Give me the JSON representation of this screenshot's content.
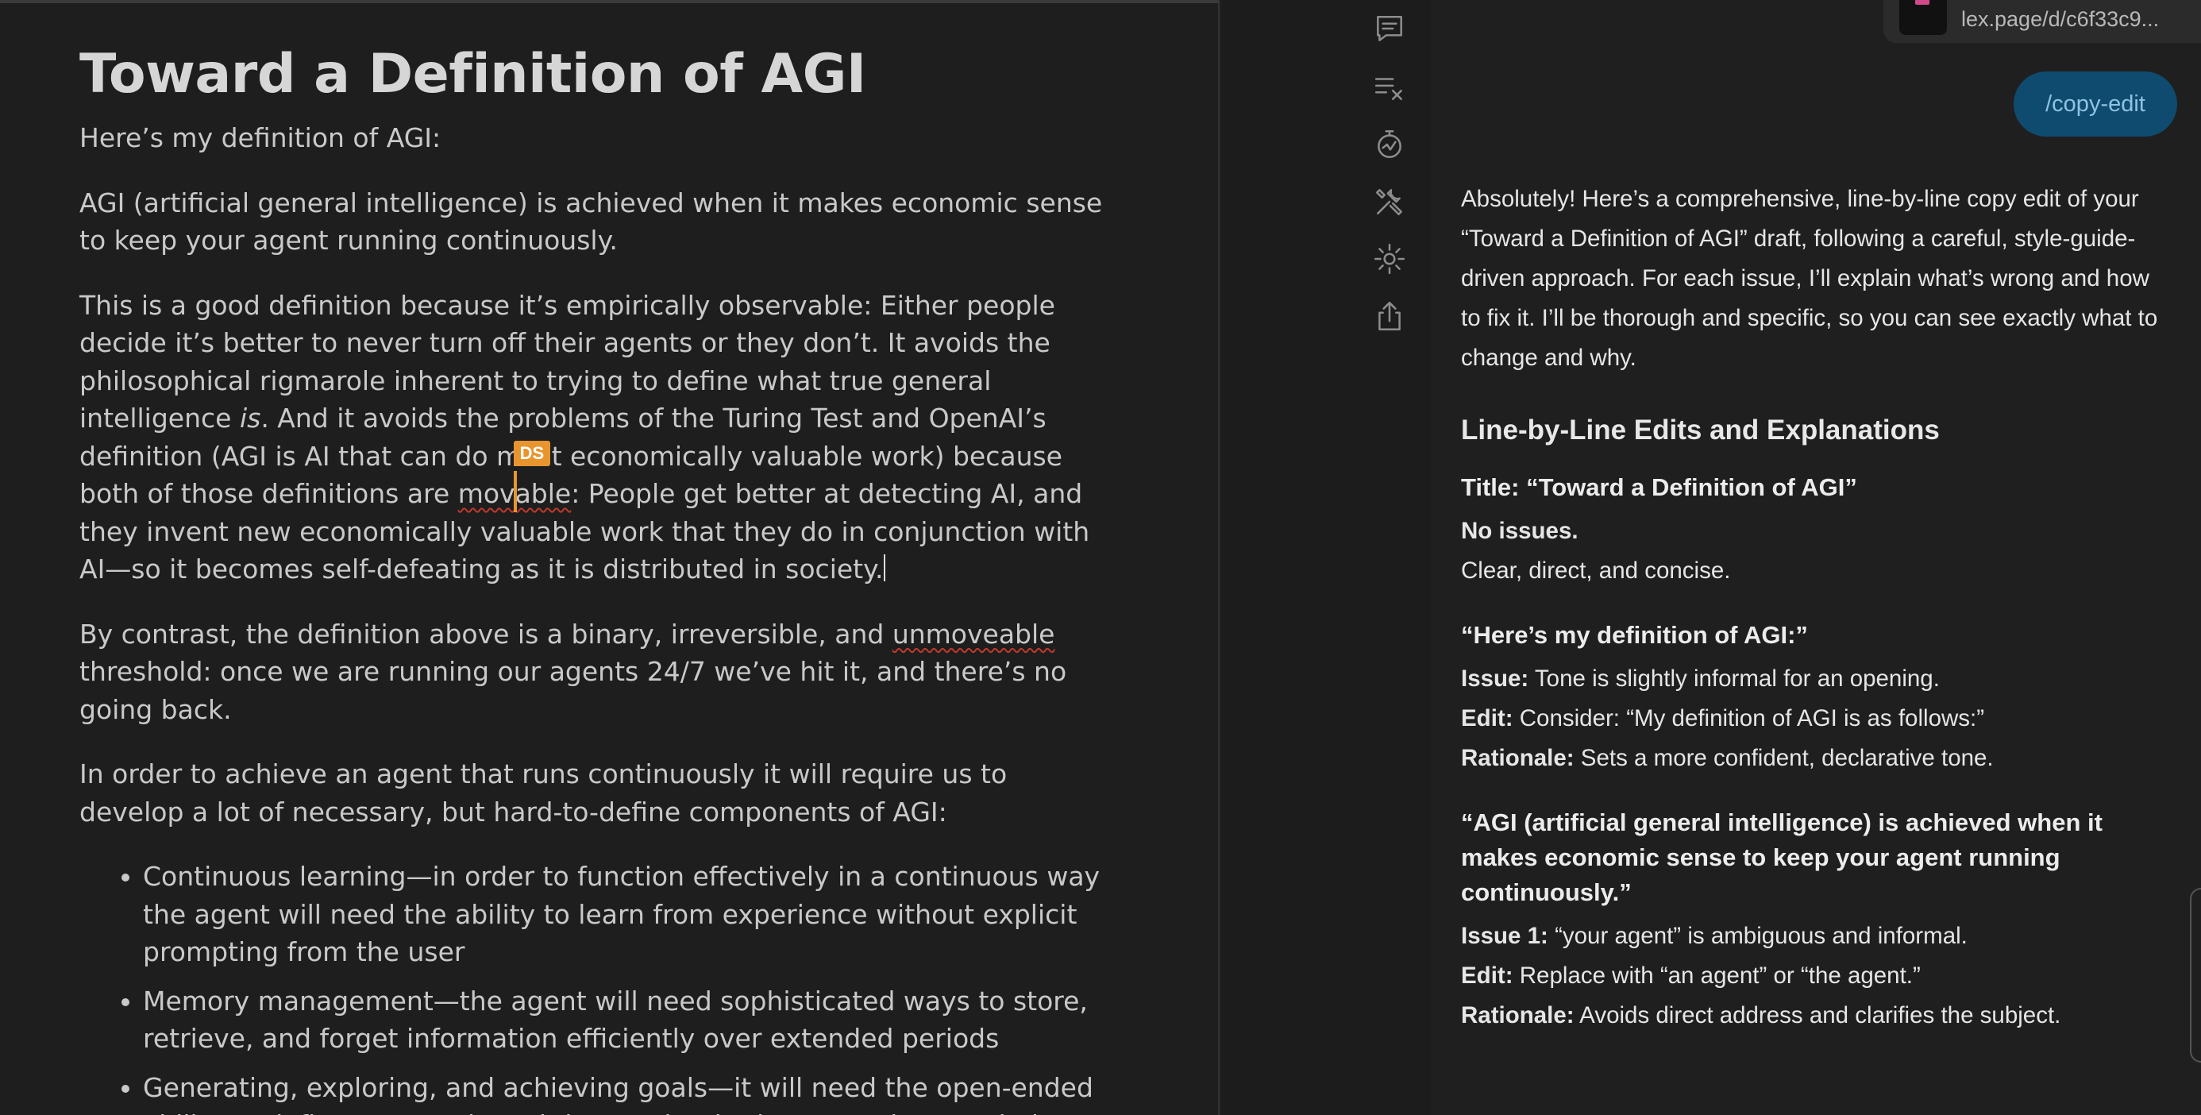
{
  "editor": {
    "title": "Toward a Definition of AGI",
    "intro": "Here’s my definition of AGI:",
    "p1": "AGI (artificial general intelligence) is achieved when it makes economic sense to keep your agent running continuously.",
    "p2a": "This is a good definition because it’s empirically observable: Either people decide it’s better to never turn off their agents or they don’t. It avoids the philosophical rigmarole inherent to trying to define what true general intelligence ",
    "p2_em": "is",
    "p2b": ". And it avoids the problems of the Turing Test and OpenAI’s definition (AGI is AI that can do most economically valuable work) because both of those definitions are ",
    "p2_spell1": "mov",
    "p2_spell2": "able",
    "p2c": ": People get better at detecting AI, and they invent new economically valuable work that they do in conjunction with AI—so it becomes self-defeating as it is distributed in society.",
    "collab_initials": "DS",
    "p3a": "By contrast, the definition above is a binary, irreversible, and ",
    "p3_spell": "unmoveable",
    "p3b": " threshold: once we are running our agents 24/7 we’ve hit it, and there’s no going back.",
    "p4": "In order to achieve an agent that runs continuously it will require us to develop a lot of necessary, but hard-to-define components of AGI:",
    "bullets": [
      "Continuous learning—in order to function effectively in a continuous way the agent will need the ability to learn from experience without explicit prompting from the user",
      "Memory management—the agent will need sophisticated ways to store, retrieve, and forget information efficiently over extended periods",
      "Generating, exploring, and achieving goals—it will need the open-ended ability to define new goals and then maintain them over long periods"
    ]
  },
  "rail": {
    "icons": [
      "comment-icon",
      "checklist-clear-icon",
      "timer-icon",
      "tools-icon",
      "settings-icon",
      "share-icon"
    ]
  },
  "chat": {
    "link_url": "lex.page/d/c6f33c9...",
    "command": "/copy-edit",
    "intro": "Absolutely! Here’s a comprehensive, line-by-line copy edit of your “Toward a Definition of AGI” draft, following a careful, style-guide-driven approach. For each issue, I’ll explain what’s wrong and how to fix it. I’ll be thorough and specific, so you can see exactly what to change and why.",
    "section_heading": "Line-by-Line Edits and Explanations",
    "items": [
      {
        "heading": "Title: “Toward a Definition of AGI”",
        "l1_label": "No issues.",
        "l2_text": "Clear, direct, and concise."
      },
      {
        "heading": "“Here’s my definition of AGI:”",
        "issue_label": "Issue:",
        "issue_text": " Tone is slightly informal for an opening.",
        "edit_label": "Edit:",
        "edit_text": " Consider: “My definition of AGI is as follows:”",
        "rat_label": "Rationale:",
        "rat_text": " Sets a more confident, declarative tone."
      },
      {
        "heading": "“AGI (artificial general intelligence) is achieved when it makes economic sense to keep your agent running continuously.”",
        "issue_label": "Issue 1:",
        "issue_text": " “your agent” is ambiguous and informal.",
        "edit_label": "Edit:",
        "edit_text": " Replace with “an agent” or “the agent.”",
        "rat_label": "Rationale:",
        "rat_text": " Avoids direct address and clarifies the subject."
      }
    ]
  }
}
